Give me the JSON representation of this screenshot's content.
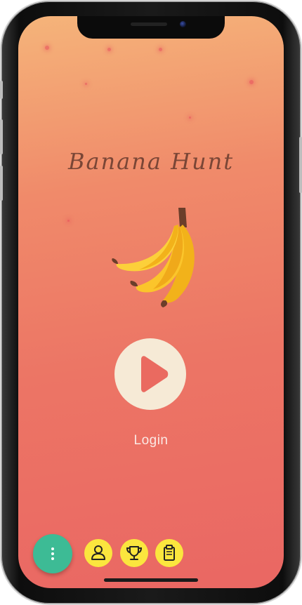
{
  "app": {
    "title": "Banana Hunt"
  },
  "main": {
    "login_label": "Login"
  },
  "icons": {
    "banana": "banana-bunch-icon",
    "play": "play-icon",
    "menu": "vertical-dots-icon",
    "profile": "user-icon",
    "leaderboard": "trophy-icon",
    "notes": "clipboard-icon"
  },
  "colors": {
    "background_top": "#f5b47a",
    "background_bottom": "#ea6763",
    "title_text": "#7a4636",
    "play_button": "#f6ead6",
    "play_triangle": "#ea6a60",
    "menu_button": "#3dbb95",
    "nav_buttons": "#fbe63e"
  }
}
